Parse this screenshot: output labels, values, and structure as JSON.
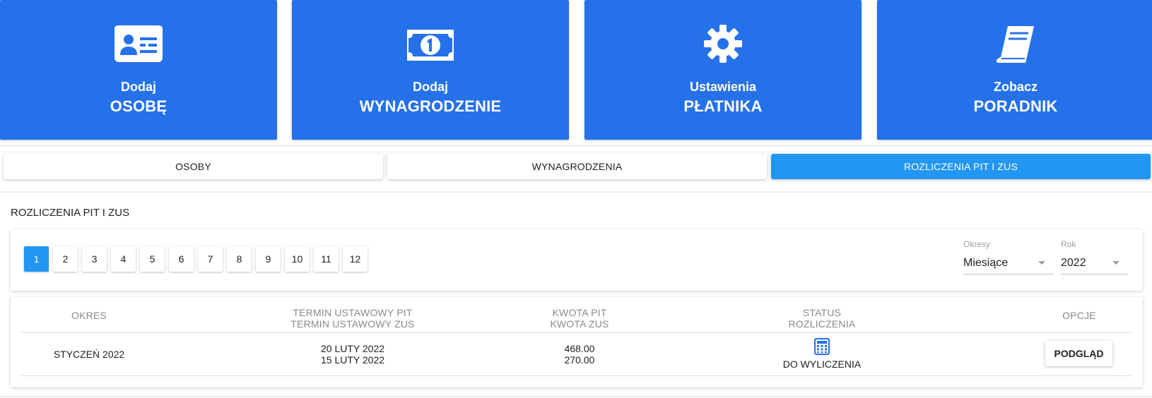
{
  "tiles": [
    {
      "small": "Dodaj",
      "big": "OSOBĘ",
      "icon": "id-card-icon"
    },
    {
      "small": "Dodaj",
      "big": "WYNAGRODZENIE",
      "icon": "banknote-icon"
    },
    {
      "small": "Ustawienia",
      "big": "PŁATNIKA",
      "icon": "gear-icon"
    },
    {
      "small": "Zobacz",
      "big": "PORADNIK",
      "icon": "book-icon"
    }
  ],
  "tabs": [
    "OSOBY",
    "WYNAGRODZENIA",
    "ROZLICZENIA PIT I ZUS"
  ],
  "active_tab": "ROZLICZENIA PIT I ZUS",
  "section_title": "ROZLICZENIA PIT I ZUS",
  "months": [
    "1",
    "2",
    "3",
    "4",
    "5",
    "6",
    "7",
    "8",
    "9",
    "10",
    "11",
    "12"
  ],
  "active_month": "1",
  "filters": {
    "period": {
      "label": "Okresy",
      "value": "Miesiące"
    },
    "year": {
      "label": "Rok",
      "value": "2022"
    }
  },
  "table": {
    "headers": {
      "period": "OKRES",
      "deadline_pit": "TERMIN USTAWOWY PIT",
      "deadline_zus": "TERMIN USTAWOWY ZUS",
      "amount_pit": "KWOTA PIT",
      "amount_zus": "KWOTA ZUS",
      "status_1": "STATUS",
      "status_2": "ROZLICZENIA",
      "options": "OPCJE"
    },
    "rows": [
      {
        "period": "STYCZEŃ 2022",
        "deadline_pit": "20 LUTY 2022",
        "deadline_zus": "15 LUTY 2022",
        "amount_pit": "468.00",
        "amount_zus": "270.00",
        "status": "DO WYLICZENIA",
        "status_icon": "calculator-icon",
        "action": "PODGLĄD"
      }
    ]
  },
  "colors": {
    "tile_blue": "#2571e9",
    "accent_blue": "#2196f3"
  }
}
